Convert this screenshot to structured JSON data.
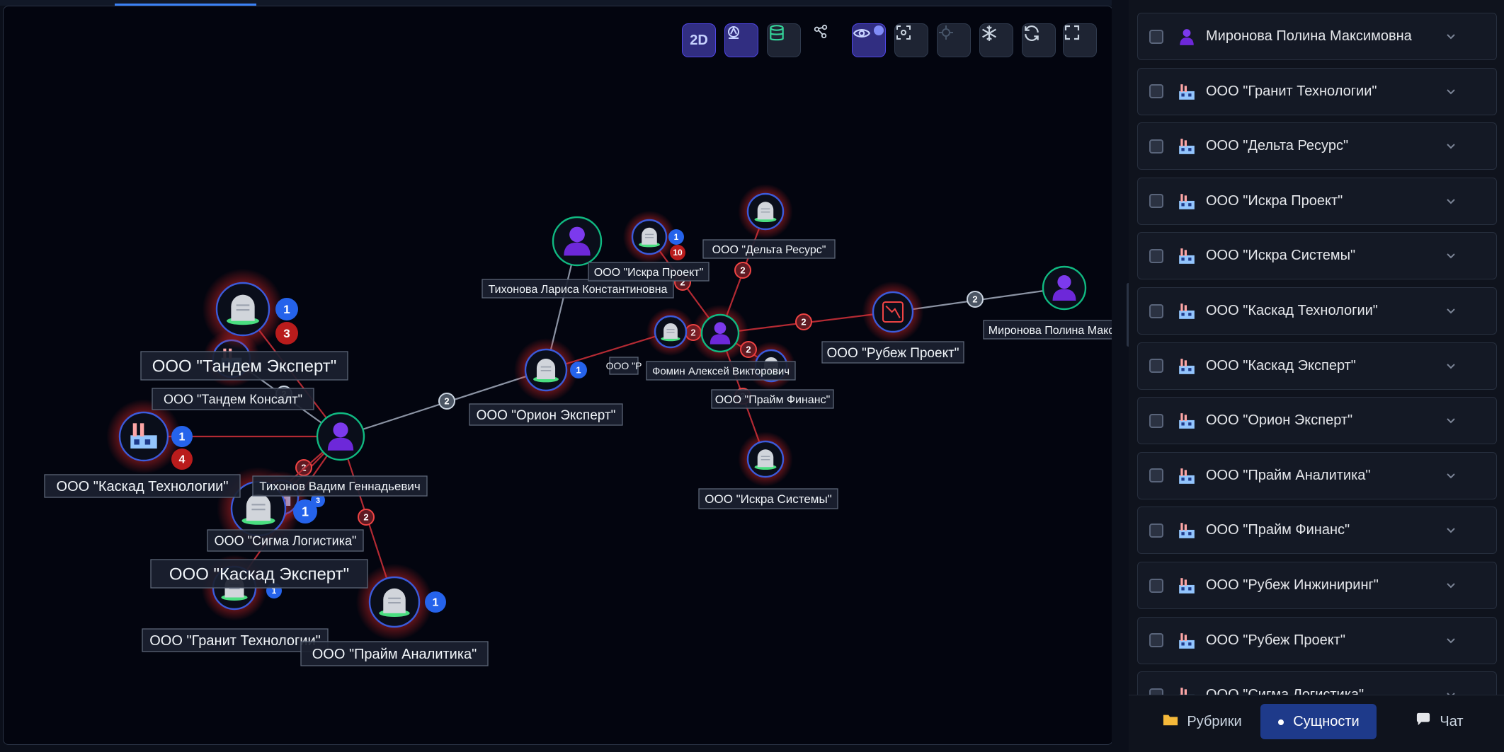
{
  "toolbar": [
    {
      "id": "mode-2d",
      "icon": "2d-mode-icon",
      "label": "2D",
      "style": "active"
    },
    {
      "id": "layout",
      "icon": "layout-icon",
      "label": "",
      "style": "active"
    },
    {
      "id": "database",
      "icon": "database-icon",
      "label": "",
      "style": "normal"
    },
    {
      "id": "graph-links",
      "icon": "graph-links-icon",
      "label": "",
      "style": "plain"
    },
    {
      "id": "visibility",
      "icon": "eye-icon",
      "label": "",
      "style": "active",
      "badge": true
    },
    {
      "id": "screenshot",
      "icon": "screenshot-icon",
      "label": "",
      "style": "normal"
    },
    {
      "id": "focus",
      "icon": "crosshair-icon",
      "label": "",
      "style": "dim"
    },
    {
      "id": "freeze",
      "icon": "snowflake-icon",
      "label": "",
      "style": "normal"
    },
    {
      "id": "refresh",
      "icon": "refresh-icon",
      "label": "",
      "style": "normal"
    },
    {
      "id": "fullscreen",
      "icon": "fullscreen-icon",
      "label": "",
      "style": "normal"
    }
  ],
  "graph": {
    "colors": {
      "link_gray": "#8b93a3",
      "link_red": "#b32a33",
      "person_ring": "#10b981",
      "company_ring": "#3b5bdb",
      "glow": "#dc2626",
      "badge_blue": "#2563eb",
      "badge_red": "#b91c1c"
    },
    "nodes": [
      {
        "id": "tikhonov-vadim",
        "kind": "person",
        "label": "Тихонов Вадим Геннадьевич"
      },
      {
        "id": "orion-expert",
        "kind": "gravestone",
        "label": "ООО \"Орион Эксперт\"",
        "badges": [
          "1"
        ]
      },
      {
        "id": "tikhonova-larisa",
        "kind": "person",
        "label": "Тихонова Лариса Константиновна"
      },
      {
        "id": "fomin-aleksey",
        "kind": "person",
        "label": "Фомин Алексей Викторович"
      },
      {
        "id": "iskra-proekt",
        "kind": "gravestone",
        "label": "ООО \"Искра Проект\"",
        "badges": [
          "1",
          "10"
        ]
      },
      {
        "id": "delta-resurs",
        "kind": "gravestone",
        "label": "ООО \"Дельта Ресурс\""
      },
      {
        "id": "hidden-company",
        "kind": "gravestone",
        "label": "ООО \"Р"
      },
      {
        "id": "praym-finans",
        "kind": "gravestone",
        "label": "ООО \"Прайм Финанс\""
      },
      {
        "id": "iskra-sistemy",
        "kind": "gravestone",
        "label": "ООО \"Искра Системы\""
      },
      {
        "id": "rubezh-proekt",
        "kind": "decline",
        "label": "ООО \"Рубеж Проект\""
      },
      {
        "id": "mironova-polina",
        "kind": "person",
        "label": "Миронова Полина Макси"
      },
      {
        "id": "tandem-konsalt",
        "kind": "factory",
        "label": "ООО \"Тандем Консалт\""
      },
      {
        "id": "tandem-expert",
        "kind": "gravestone",
        "label": "ООО \"Тандем Эксперт\"",
        "badges": [
          "1",
          "3"
        ]
      },
      {
        "id": "kaskad-tekhnologii",
        "kind": "factory",
        "label": "ООО \"Каскад Технологии\"",
        "badges": [
          "1",
          "4"
        ]
      },
      {
        "id": "sigma-logistika",
        "kind": "factory",
        "label": "ООО \"Сигма Логистика\"",
        "badges": [
          "3"
        ]
      },
      {
        "id": "kaskad-expert",
        "kind": "gravestone",
        "label": "ООО \"Каскад Эксперт\"",
        "badges": [
          "1"
        ]
      },
      {
        "id": "granit-tekhnologii",
        "kind": "gravestone",
        "label": "ООО \"Гранит Технологии\"",
        "badges": [
          "1"
        ]
      },
      {
        "id": "praym-analitika",
        "kind": "gravestone",
        "label": "ООО \"Прайм Аналитика\"",
        "badges": [
          "1"
        ]
      }
    ],
    "edges": [
      {
        "from": "tikhonov-vadim",
        "to": "orion-expert",
        "kind": "gray",
        "count": "2"
      },
      {
        "from": "orion-expert",
        "to": "tikhonova-larisa",
        "kind": "gray"
      },
      {
        "from": "orion-expert",
        "to": "hidden-company",
        "kind": "red"
      },
      {
        "from": "fomin-aleksey",
        "to": "hidden-company",
        "kind": "red",
        "count": "2"
      },
      {
        "from": "fomin-aleksey",
        "to": "iskra-proekt",
        "kind": "red",
        "count": "2"
      },
      {
        "from": "fomin-aleksey",
        "to": "delta-resurs",
        "kind": "red",
        "count": "2"
      },
      {
        "from": "fomin-aleksey",
        "to": "rubezh-proekt",
        "kind": "red",
        "count": "2"
      },
      {
        "from": "fomin-aleksey",
        "to": "praym-finans",
        "kind": "red",
        "count": "2"
      },
      {
        "from": "fomin-aleksey",
        "to": "iskra-sistemy",
        "kind": "red",
        "count": "2"
      },
      {
        "from": "rubezh-proekt",
        "to": "mironova-polina",
        "kind": "gray",
        "count": "2"
      },
      {
        "from": "tikhonov-vadim",
        "to": "tandem-konsalt",
        "kind": "gray",
        "count": "2"
      },
      {
        "from": "tikhonov-vadim",
        "to": "tandem-expert",
        "kind": "red"
      },
      {
        "from": "tikhonov-vadim",
        "to": "kaskad-tekhnologii",
        "kind": "red"
      },
      {
        "from": "tikhonov-vadim",
        "to": "sigma-logistika",
        "kind": "red",
        "count": "2"
      },
      {
        "from": "tikhonov-vadim",
        "to": "kaskad-expert",
        "kind": "red"
      },
      {
        "from": "tikhonov-vadim",
        "to": "granit-tekhnologii",
        "kind": "red"
      },
      {
        "from": "tikhonov-vadim",
        "to": "praym-analitika",
        "kind": "red",
        "count": "2"
      }
    ]
  },
  "entities": [
    {
      "name": "Миронова Полина Максимовна",
      "icon": "person-icon"
    },
    {
      "name": "ООО \"Гранит Технологии\"",
      "icon": "factory-icon"
    },
    {
      "name": "ООО \"Дельта Ресурс\"",
      "icon": "factory-icon"
    },
    {
      "name": "ООО \"Искра Проект\"",
      "icon": "factory-icon"
    },
    {
      "name": "ООО \"Искра Системы\"",
      "icon": "factory-icon"
    },
    {
      "name": "ООО \"Каскад Технологии\"",
      "icon": "factory-icon"
    },
    {
      "name": "ООО \"Каскад Эксперт\"",
      "icon": "factory-icon"
    },
    {
      "name": "ООО \"Орион Эксперт\"",
      "icon": "factory-icon"
    },
    {
      "name": "ООО \"Прайм Аналитика\"",
      "icon": "factory-icon"
    },
    {
      "name": "ООО \"Прайм Финанс\"",
      "icon": "factory-icon"
    },
    {
      "name": "ООО \"Рубеж Инжиниринг\"",
      "icon": "factory-icon"
    },
    {
      "name": "ООО \"Рубеж Проект\"",
      "icon": "factory-icon"
    },
    {
      "name": "ООО \"Сигма Логистика\"",
      "icon": "factory-icon"
    }
  ],
  "bottom_tabs": [
    {
      "id": "rubrics",
      "label": "Рубрики",
      "icon": "folder-icon",
      "active": false
    },
    {
      "id": "entities",
      "label": "Сущности",
      "icon": "dot-icon",
      "active": true
    },
    {
      "id": "chat",
      "label": "Чат",
      "icon": "chat-bubble-icon",
      "active": false
    }
  ]
}
